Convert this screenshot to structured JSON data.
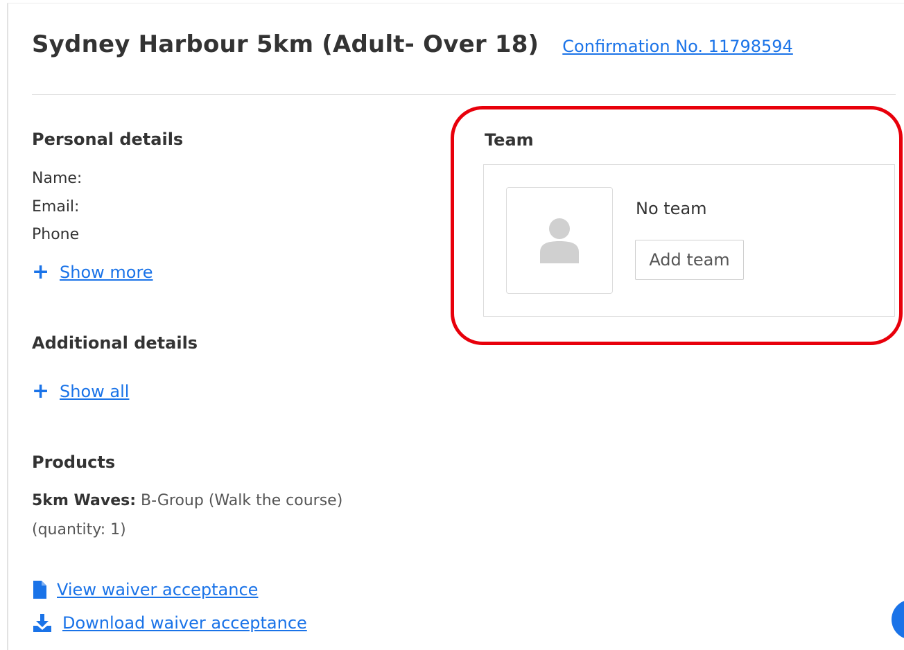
{
  "header": {
    "event_title": "Sydney Harbour 5km (Adult- Over 18)",
    "confirmation_link": "Confirmation No. 11798594"
  },
  "personal_details": {
    "title": "Personal details",
    "name_label": "Name:",
    "email_label": "Email:",
    "phone_label": "Phone",
    "show_more_label": "Show more",
    "toggle_icon": "plus-icon"
  },
  "additional_details": {
    "title": "Additional details",
    "show_all_label": "Show all"
  },
  "products": {
    "title": "Products",
    "item_label": "5km Waves:",
    "item_value": "B-Group (Walk the course)",
    "quantity": "(quantity: 1)"
  },
  "waiver": {
    "view_label": "View waiver acceptance",
    "view_icon": "document-icon",
    "download_label": "Download waiver acceptance",
    "download_icon": "download-icon"
  },
  "team": {
    "title": "Team",
    "status": "No team",
    "add_button_label": "Add team",
    "avatar_icon": "person-placeholder-icon"
  },
  "colors": {
    "link": "#1a73e8",
    "highlight": "#e8000b",
    "text": "#333333",
    "avatar_placeholder": "#d0d0d0"
  }
}
